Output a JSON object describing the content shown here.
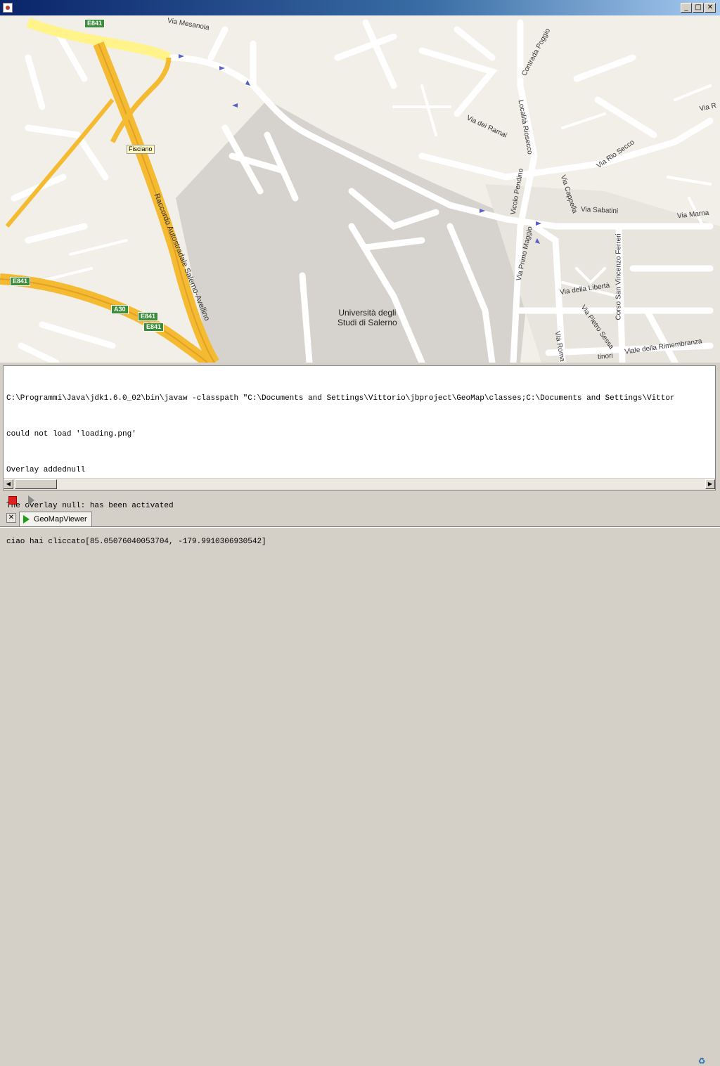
{
  "window": {
    "title": "",
    "minimize_label": "_",
    "maximize_label": "□",
    "close_label": "✕"
  },
  "map": {
    "shields": [
      "E841",
      "E841",
      "A30",
      "E841",
      "E841"
    ],
    "place_marker": "Fisciano",
    "university_line1": "Università degli",
    "university_line2": "Studi di Salerno",
    "streets": [
      "Via Mesanoia",
      "Contrada Poggio",
      "Località Riosecco",
      "Via dei Ramai",
      "Via Rio Secco",
      "Via R",
      "Vicolo Pendino",
      "Via Cappella",
      "Via Sabatini",
      "Via Marna",
      "Raccordo Autostradale Salerno-Avellino",
      "Via Primo Maggio",
      "Corso San Vincenzo Ferreri",
      "Via della Libertà",
      "Via Pietro Sessa",
      "Via Roma",
      "Viale della Rimembranza",
      "tinori"
    ],
    "colors": {
      "background": "#f2efe9",
      "campus": "#d6d3ce",
      "road": "#ffffff",
      "highway": "#f4bb32",
      "highway_light": "#fff38a",
      "shield": "#3a8e3a",
      "arrow": "#5560c8"
    }
  },
  "console": {
    "lines": [
      "C:\\Programmi\\Java\\jdk1.6.0_02\\bin\\javaw -classpath \"C:\\Documents and Settings\\Vittorio\\jbproject\\GeoMap\\classes;C:\\Documents and Settings\\Vittor",
      "could not load 'loading.png'",
      "Overlay addednull",
      "The overlay null: has been activated",
      "ciao hai cliccato[85.05076040053704, -179.9910306930542]"
    ]
  },
  "toolbar": {
    "stop_icon": "stop-icon",
    "run_icon": "run-icon"
  },
  "tabs": [
    {
      "label": "GeoMapViewer",
      "icon": "run-icon"
    }
  ],
  "status": {
    "icon": "recycle-icon"
  }
}
